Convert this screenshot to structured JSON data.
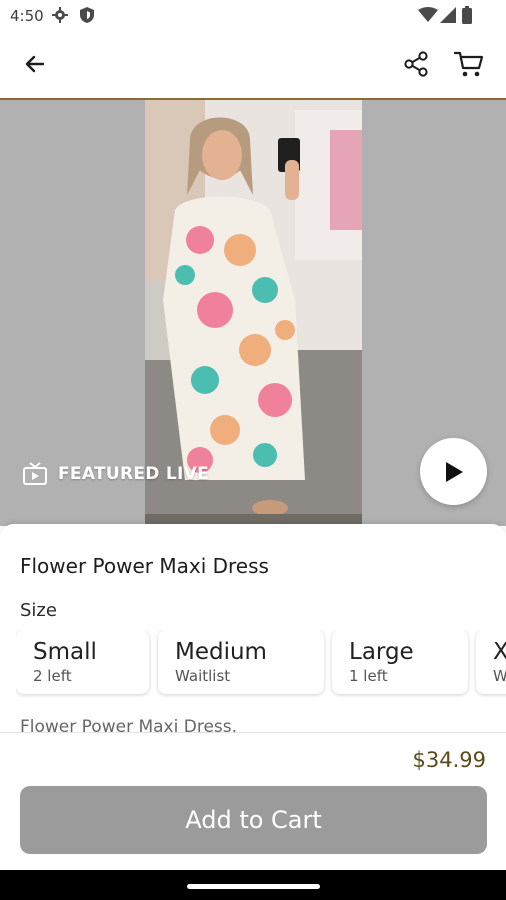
{
  "status_bar": {
    "time": "4:50"
  },
  "media": {
    "featured_label": "FEATURED LIVE"
  },
  "product": {
    "title": "Flower Power Maxi Dress",
    "size_heading": "Size",
    "sizes": [
      {
        "name": "Small",
        "availability": "2 left"
      },
      {
        "name": "Medium",
        "availability": "Waitlist"
      },
      {
        "name": "Large",
        "availability": "1 left"
      },
      {
        "name": "X",
        "availability": "W"
      }
    ],
    "description": "Flower Power Maxi Dress.",
    "price": "$34.99",
    "add_to_cart_label": "Add to Cart"
  },
  "colors": {
    "price": "#5c4a1a",
    "button_disabled": "#9b9b9b",
    "media_background": "#b1b1b1"
  },
  "icons": {
    "back": "arrow-left-icon",
    "share": "share-icon",
    "cart": "cart-icon",
    "play": "play-icon",
    "featured": "tv-icon"
  }
}
